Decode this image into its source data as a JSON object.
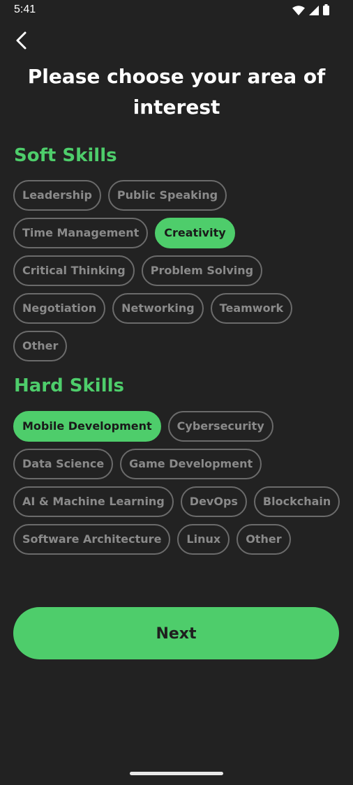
{
  "status_bar": {
    "time": "5:41",
    "icons": [
      "wifi-icon",
      "signal-icon",
      "battery-icon"
    ]
  },
  "header": {
    "back_icon": "chevron-left-icon",
    "title": "Please choose your area of interest"
  },
  "soft_skills": {
    "heading": "Soft Skills",
    "chips": [
      {
        "label": "Leadership",
        "selected": false
      },
      {
        "label": "Public Speaking",
        "selected": false
      },
      {
        "label": "Time Management",
        "selected": false
      },
      {
        "label": "Creativity",
        "selected": true
      },
      {
        "label": "Critical Thinking",
        "selected": false
      },
      {
        "label": "Problem Solving",
        "selected": false
      },
      {
        "label": "Negotiation",
        "selected": false
      },
      {
        "label": "Networking",
        "selected": false
      },
      {
        "label": "Teamwork",
        "selected": false
      },
      {
        "label": "Other",
        "selected": false
      }
    ]
  },
  "hard_skills": {
    "heading": "Hard Skills",
    "chips": [
      {
        "label": "Mobile Development",
        "selected": true
      },
      {
        "label": "Cybersecurity",
        "selected": false
      },
      {
        "label": "Data Science",
        "selected": false
      },
      {
        "label": "Game Development",
        "selected": false
      },
      {
        "label": "AI & Machine Learning",
        "selected": false
      },
      {
        "label": "DevOps",
        "selected": false
      },
      {
        "label": "Blockchain",
        "selected": false
      },
      {
        "label": "Software Architecture",
        "selected": false
      },
      {
        "label": "Linux",
        "selected": false
      },
      {
        "label": "Other",
        "selected": false
      }
    ]
  },
  "next_button": {
    "label": "Next"
  },
  "colors": {
    "background": "#222222",
    "accent": "#4ecd6b",
    "chip_border": "#6b6b6b",
    "chip_text": "#8a8a8a"
  }
}
